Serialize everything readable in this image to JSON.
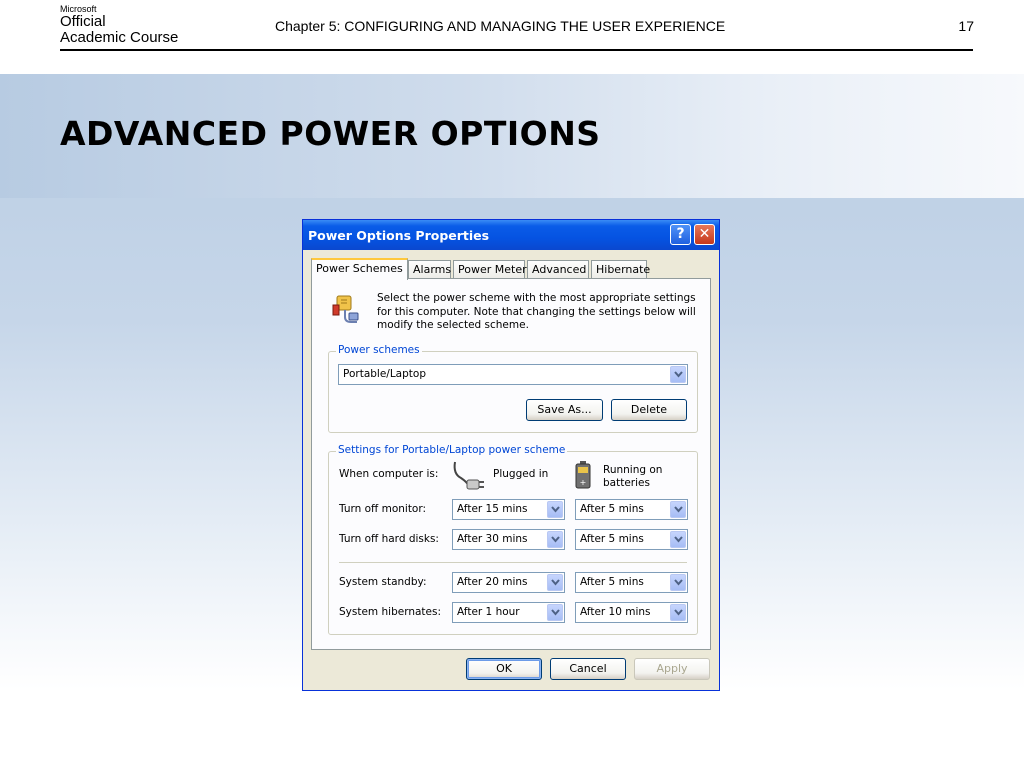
{
  "header": {
    "logo_line1": "Microsoft",
    "logo_line2": "Official",
    "logo_line3": "Academic Course",
    "chapter": "Chapter 5: CONFIGURING AND MANAGING THE USER EXPERIENCE",
    "page_number": "17"
  },
  "slide_title": "ADVANCED POWER OPTIONS",
  "dialog": {
    "title": "Power Options Properties",
    "help_button": "?",
    "close_button": "✕",
    "tabs": [
      {
        "label": "Power Schemes",
        "active": true
      },
      {
        "label": "Alarms"
      },
      {
        "label": "Power Meter"
      },
      {
        "label": "Advanced"
      },
      {
        "label": "Hibernate"
      }
    ],
    "intro_text": "Select the power scheme with the most appropriate settings for this computer. Note that changing the settings below will modify the selected scheme.",
    "schemes_group_label": "Power schemes",
    "scheme_selected": "Portable/Laptop",
    "save_as_button": "Save As...",
    "delete_button": "Delete",
    "settings_group_label": "Settings for Portable/Laptop power scheme",
    "when_computer_is": "When computer is:",
    "plugged_in": "Plugged in",
    "running_on_batteries_1": "Running on",
    "running_on_batteries_2": "batteries",
    "rows": [
      {
        "label": "Turn off monitor:",
        "plugged": "After 15 mins",
        "battery": "After 5 mins"
      },
      {
        "label": "Turn off hard disks:",
        "plugged": "After 30 mins",
        "battery": "After 5 mins"
      },
      {
        "label": "System standby:",
        "plugged": "After 20 mins",
        "battery": "After 5 mins"
      },
      {
        "label": "System hibernates:",
        "plugged": "After 1 hour",
        "battery": "After 10 mins"
      }
    ],
    "ok_button": "OK",
    "cancel_button": "Cancel",
    "apply_button": "Apply"
  },
  "colors": {
    "titlebar": "#0553e2",
    "group_label": "#0046d5",
    "dialog_bg": "#ece9d8"
  }
}
